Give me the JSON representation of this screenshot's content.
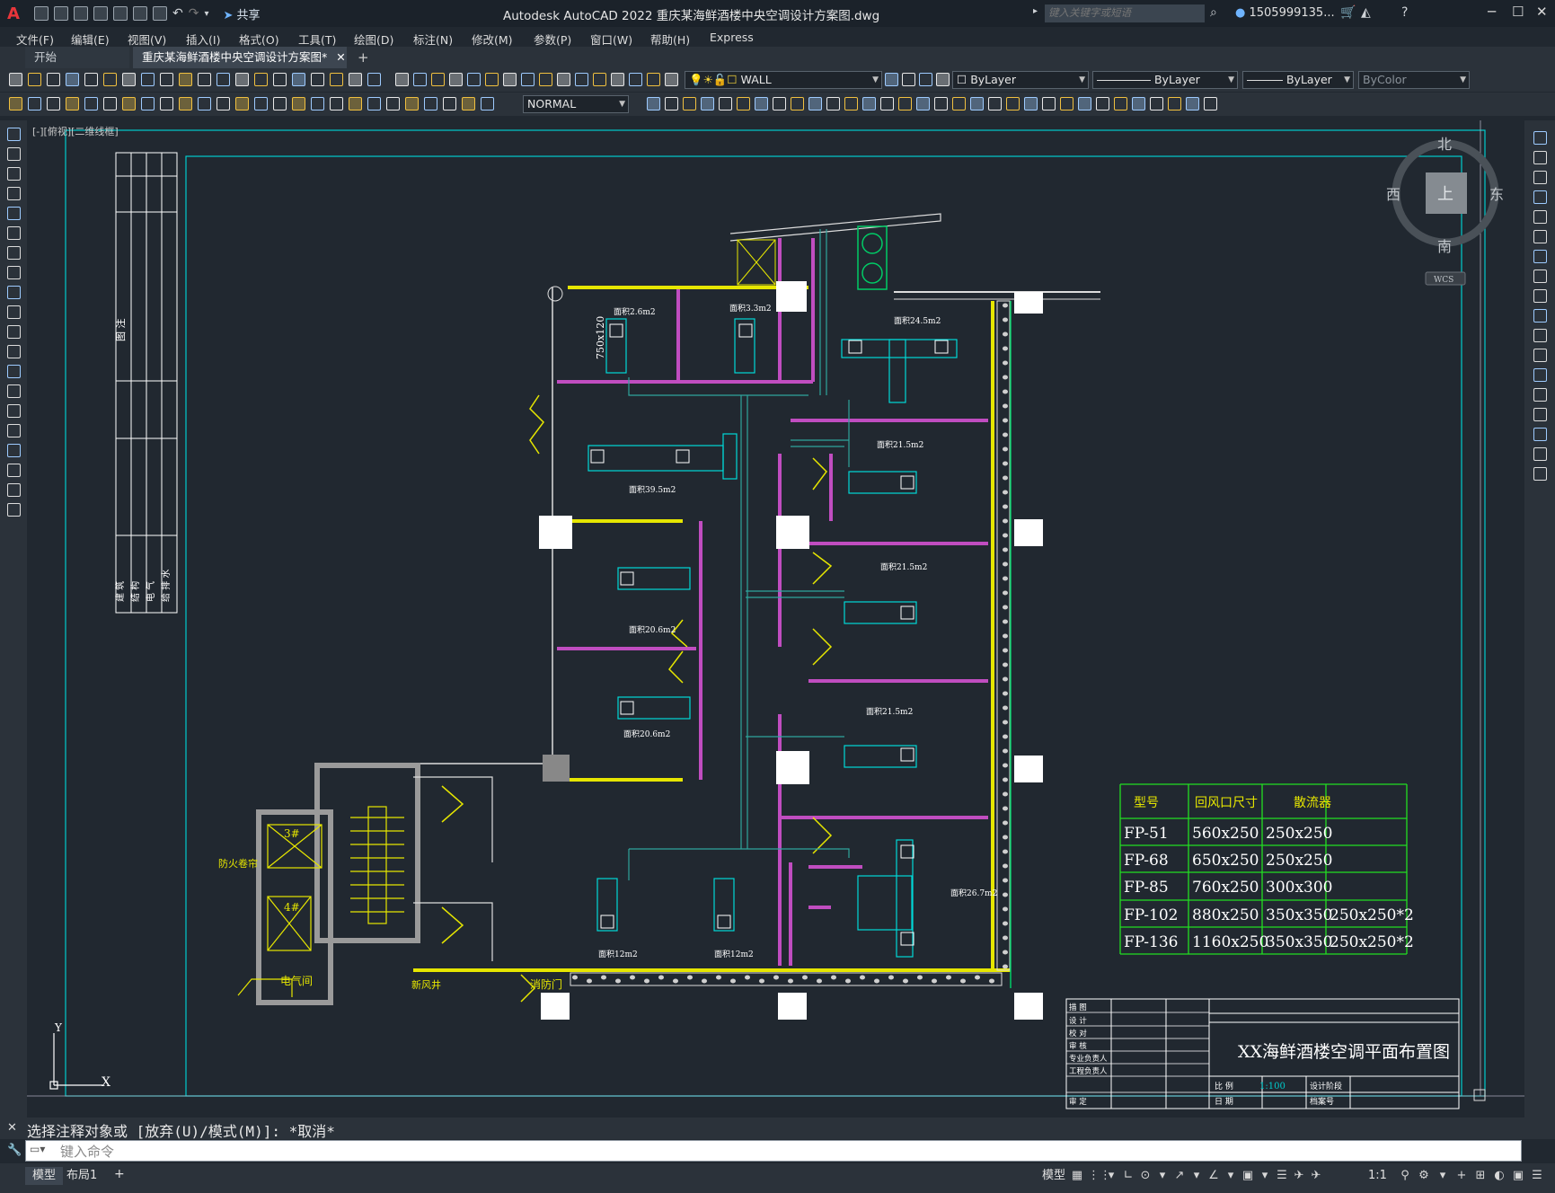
{
  "app": {
    "title": "Autodesk AutoCAD 2022    重庆某海鲜酒楼中央空调设计方案图.dwg",
    "share_label": "共享",
    "search_placeholder": "键入关键字或短语",
    "user": "1505999135...",
    "logo": "A"
  },
  "menu": [
    "文件(F)",
    "编辑(E)",
    "视图(V)",
    "插入(I)",
    "格式(O)",
    "工具(T)",
    "绘图(D)",
    "标注(N)",
    "修改(M)",
    "参数(P)",
    "窗口(W)",
    "帮助(H)",
    "Express"
  ],
  "tabs": {
    "start": "开始",
    "drawing": "重庆某海鲜酒楼中央空调设计方案图*"
  },
  "layer_combo": "WALL",
  "color_combo": "ByLayer",
  "linetype_combo": "ByLayer",
  "lineweight_combo": "ByLayer",
  "plotstyle_combo": "ByColor",
  "dimstyle_combo": "NORMAL",
  "view_label": "[-][俯视][二维线框]",
  "viewcube": {
    "north": "北",
    "south": "南",
    "east": "东",
    "west": "西",
    "top": "上",
    "wcs": "WCS"
  },
  "ucs": {
    "x": "X",
    "y": "Y"
  },
  "drawing": {
    "rooms": [
      {
        "label": "面积2.6m2"
      },
      {
        "label": "面积3.3m2"
      },
      {
        "label": "面积24.5m2"
      },
      {
        "label": "面积39.5m2"
      },
      {
        "label": "面积21.5m2"
      },
      {
        "label": "面积21.5m2"
      },
      {
        "label": "面积20.6m2"
      },
      {
        "label": "面积20.6m2"
      },
      {
        "label": "面积21.5m2"
      },
      {
        "label": "面积12m2"
      },
      {
        "label": "面积12m2"
      },
      {
        "label": "面积26.7m2"
      }
    ],
    "duct_dim": "750x120",
    "door_label": "消防门",
    "stair_labels": {
      "elev3": "3#",
      "elev4": "4#",
      "elec": "电气间",
      "fire": "防火卷帘",
      "fan": "新风井"
    },
    "left_table": {
      "top_text": "图 注",
      "bottom_cols": [
        "建 筑",
        "结 构",
        "电 气",
        "给 排 水"
      ]
    }
  },
  "spec_table": {
    "headers": [
      "型号",
      "回风口尺寸",
      "散流器"
    ],
    "rows": [
      [
        "FP-51",
        "560x250",
        "250x250",
        ""
      ],
      [
        "FP-68",
        "650x250",
        "250x250",
        ""
      ],
      [
        "FP-85",
        "760x250",
        "300x300",
        ""
      ],
      [
        "FP-102",
        "880x250",
        "350x350",
        "250x250*2"
      ],
      [
        "FP-136",
        "1160x250",
        "350x350",
        "250x250*2"
      ]
    ]
  },
  "title_block": {
    "title": "XX海鲜酒楼空调平面布置图",
    "left_rows": [
      "描 图",
      "设 计",
      "校 对",
      "审 核",
      "专业负责人",
      "工程负责人",
      "审 定"
    ],
    "scale_label": "比 例",
    "scale_value": "1:100",
    "stage_label": "设计阶段",
    "date_label": "日 期",
    "file_label": "档案号"
  },
  "command": {
    "history": "选择注释对象或 [放弃(U)/模式(M)]: *取消*",
    "placeholder": "键入命令"
  },
  "status": {
    "model": "模型",
    "layout1": "布局1",
    "model_btn": "模型",
    "scale": "1:1"
  },
  "colors": {
    "wall_magenta": "#c04dc0",
    "wall_yellow": "#e6e600",
    "duct_cyan": "#00e0e0",
    "pipe_green": "#00cc66",
    "table_green": "#22dd22",
    "border_cyan": "#00cccc"
  }
}
